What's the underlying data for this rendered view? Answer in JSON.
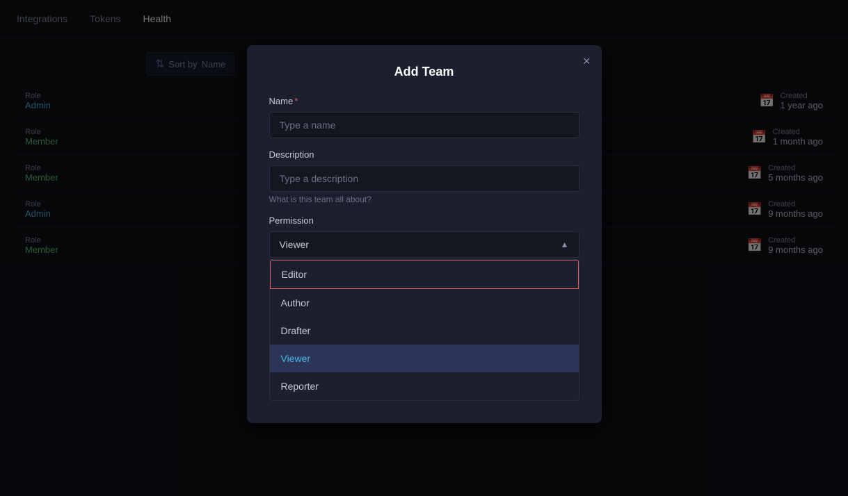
{
  "nav": {
    "items": [
      {
        "label": "Integrations",
        "active": false
      },
      {
        "label": "Tokens",
        "active": false
      },
      {
        "label": "Health",
        "active": true
      }
    ]
  },
  "sort_bar": {
    "label": "Sort by",
    "value": "Name"
  },
  "table": {
    "rows": [
      {
        "role_label": "Role",
        "role_value": "Admin",
        "role_type": "admin",
        "created_label": "Created",
        "created_time": "1 year ago"
      },
      {
        "role_label": "Role",
        "role_value": "Member",
        "role_type": "member",
        "created_label": "Created",
        "created_time": "1 month ago"
      },
      {
        "role_label": "Role",
        "role_value": "Member",
        "role_type": "member",
        "created_label": "Created",
        "created_time": "5 months ago"
      },
      {
        "role_label": "Role",
        "role_value": "Admin",
        "role_type": "admin",
        "created_label": "Created",
        "created_time": "9 months ago"
      },
      {
        "role_label": "Role",
        "role_value": "Member",
        "role_type": "member",
        "created_label": "Created",
        "created_time": "9 months ago"
      }
    ]
  },
  "modal": {
    "title": "Add Team",
    "close_label": "×",
    "name_label": "Name",
    "name_required": true,
    "name_placeholder": "Type a name",
    "description_label": "Description",
    "description_placeholder": "Type a description",
    "description_hint": "What is this team all about?",
    "permission_label": "Permission",
    "permission_selected": "Viewer",
    "permission_options": [
      {
        "value": "Editor",
        "highlighted": true,
        "selected": false
      },
      {
        "value": "Author",
        "highlighted": false,
        "selected": false
      },
      {
        "value": "Drafter",
        "highlighted": false,
        "selected": false
      },
      {
        "value": "Viewer",
        "highlighted": false,
        "selected": true
      },
      {
        "value": "Reporter",
        "highlighted": false,
        "selected": false
      }
    ]
  }
}
